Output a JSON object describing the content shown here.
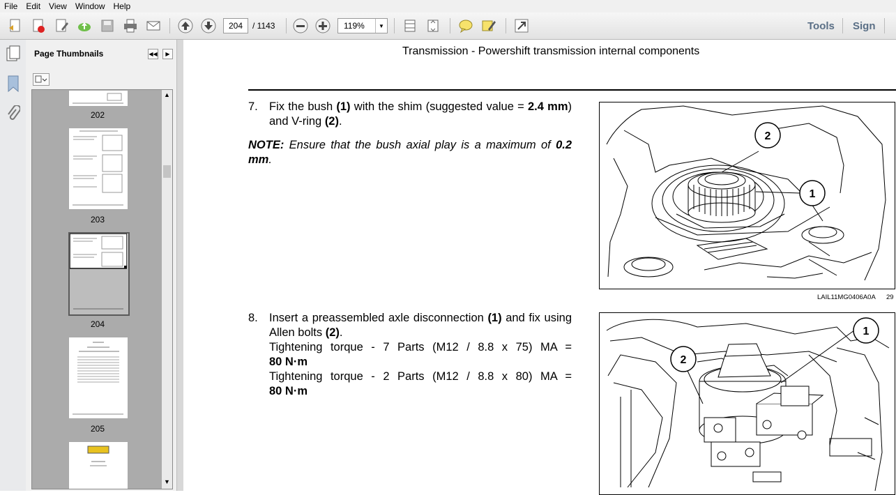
{
  "menu": [
    "File",
    "Edit",
    "View",
    "Window",
    "Help"
  ],
  "toolbar": {
    "current_page": "204",
    "page_total": "/ 1143",
    "zoom": "119%",
    "tools_label": "Tools",
    "sign_label": "Sign"
  },
  "panel": {
    "title": "Page Thumbnails",
    "thumb_labels": [
      "202",
      "203",
      "204",
      "205"
    ]
  },
  "document": {
    "header": "Transmission - Powershift transmission internal components",
    "step7": {
      "num": "7.",
      "t1": "Fix the bush ",
      "b1": "(1)",
      "t2": " with the shim (suggested value = ",
      "b2": "2.4 mm",
      "t3": ") and V-ring ",
      "b3": "(2)",
      "t4": "."
    },
    "note": {
      "label": "NOTE:",
      "text": " Ensure that the bush axial play is a maximum of ",
      "value": "0.2 mm",
      "end": "."
    },
    "step8": {
      "num": "8.",
      "t1": "Insert a preassembled axle disconnection ",
      "b1": "(1)",
      "t2": " and fix using Allen bolts ",
      "b2": "(2)",
      "t3": ".",
      "line2": "Tightening torque - 7 Parts (M12 / 8.8 x 75) MA =",
      "line2b": "80 N·m",
      "line3": "Tightening torque - 2 Parts (M12 / 8.8 x 80) MA =",
      "line3b": "80 N·m"
    },
    "figure1": {
      "code": "LAIL11MG0406A0A",
      "number": "29",
      "callouts": [
        "2",
        "1"
      ]
    },
    "figure2": {
      "callouts": [
        "1",
        "2"
      ]
    }
  }
}
